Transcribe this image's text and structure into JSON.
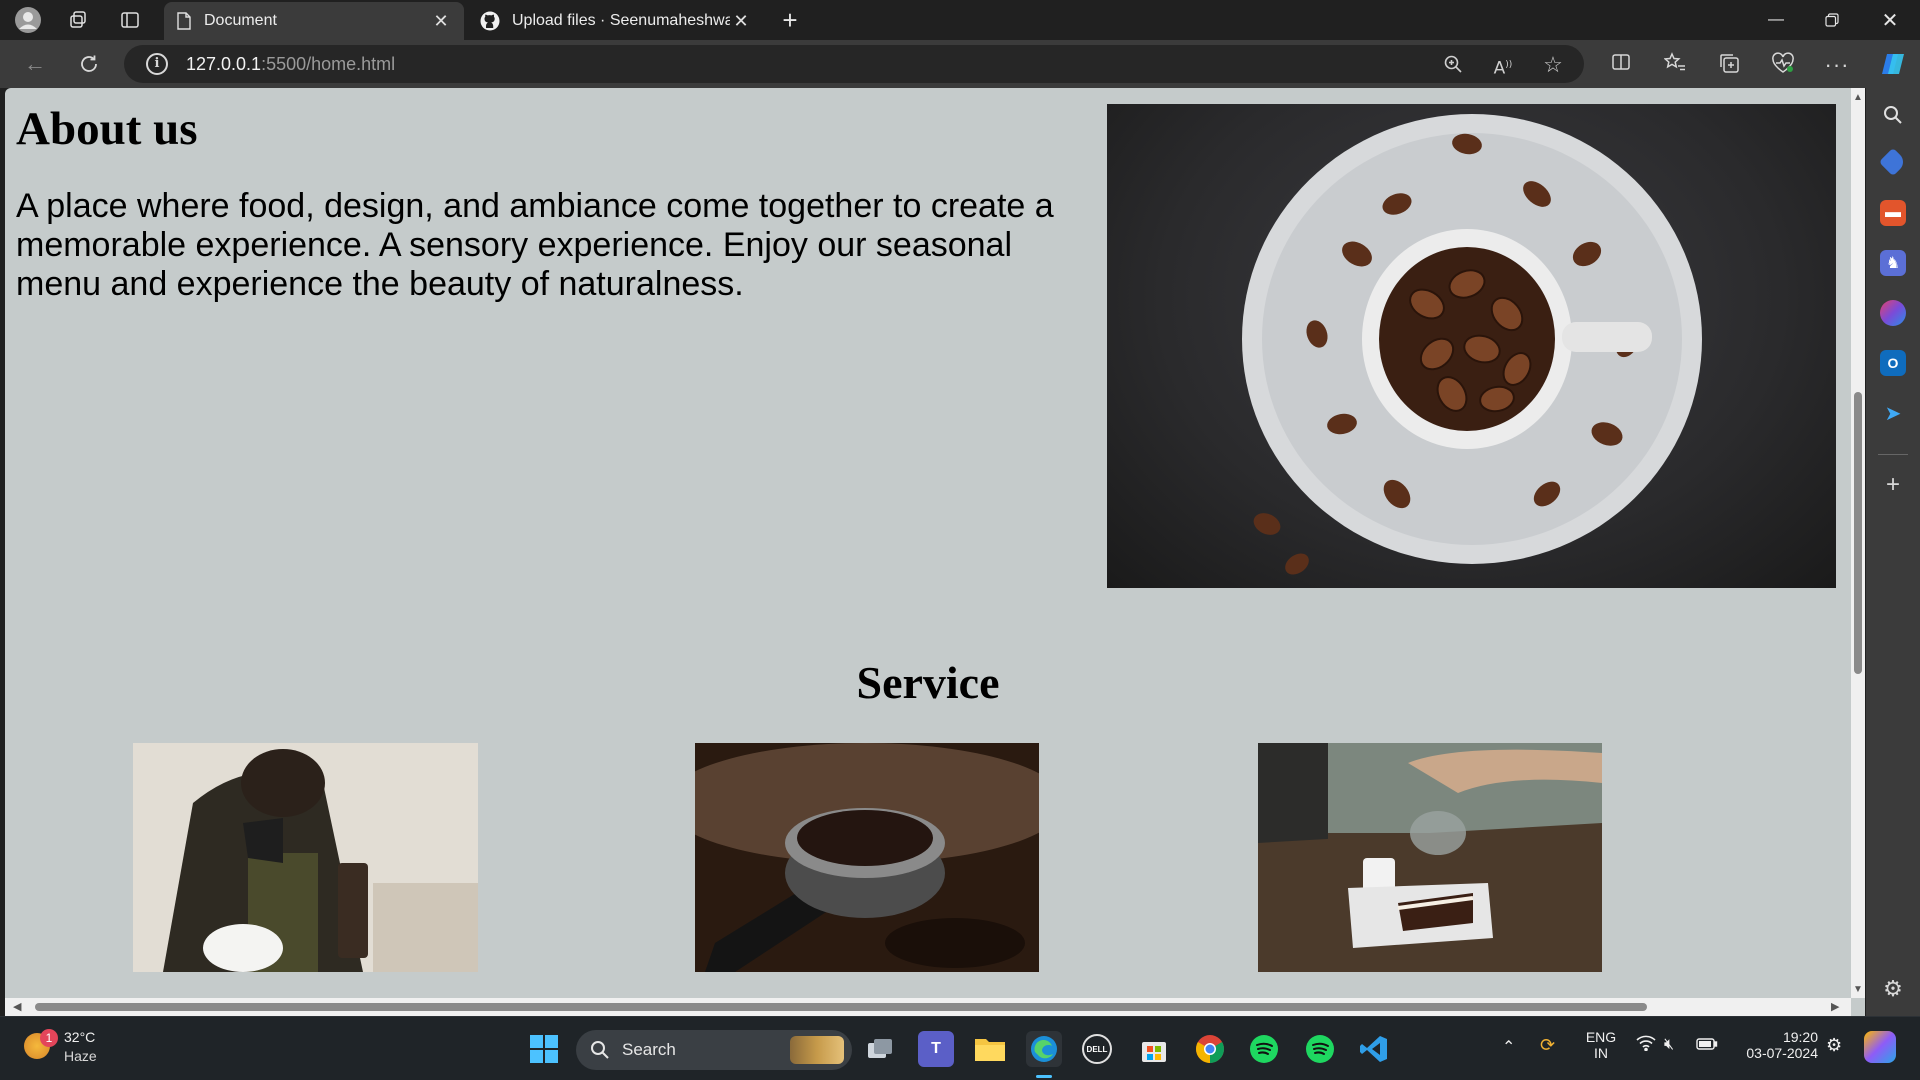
{
  "browser": {
    "tabs": [
      {
        "title": "Document",
        "active": true
      },
      {
        "title": "Upload files · Seenumaheshwaran",
        "active": false
      }
    ],
    "url_host": "127.0.0.1",
    "url_path": ":5500/home.html"
  },
  "page": {
    "about_title": "About us",
    "about_text": "A place where food, design, and ambiance come together to create a memorable experience. A sensory experience. Enjoy our seasonal menu and experience the beauty of naturalness.",
    "service_title": "Service",
    "images": [
      "coffee-beans-cup",
      "barista-pour-over",
      "espresso-portafilter",
      "coffee-and-cake"
    ]
  },
  "taskbar": {
    "weather_temp": "32°C",
    "weather_desc": "Haze",
    "weather_badge": "1",
    "search_label": "Search",
    "lang_top": "ENG",
    "lang_bottom": "IN",
    "time": "19:20",
    "date": "03-07-2024"
  },
  "colors": {
    "page_bg": "#c5cbcb",
    "chrome_dark": "#202020",
    "toolbar": "#3b3b3b"
  }
}
